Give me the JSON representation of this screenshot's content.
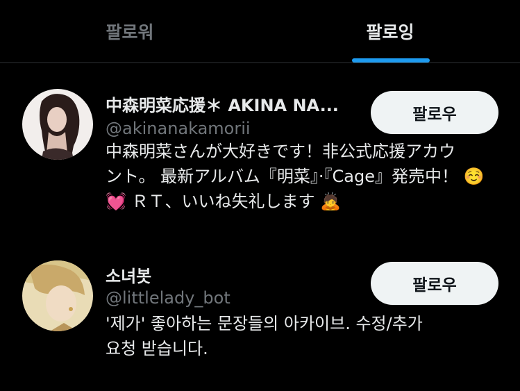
{
  "tabs": {
    "followers_label": "팔로워",
    "following_label": "팔로잉"
  },
  "users": [
    {
      "name": "中森明菜応援＊ AKINA NA...",
      "handle": "@akinanakamorii",
      "bio_line1": "中森明菜さんが大好きです！非公式応援アカウ",
      "bio_line2": "ント。 最新アルバム『明菜』·『Cage』発売中！ ☺️",
      "bio_line3": "💓 ＲＴ、いいね失礼します 🙇",
      "follow_label": "팔로우"
    },
    {
      "name": "소녀봇",
      "handle": "@littlelady_bot",
      "bio_line1": "'제가' 좋아하는 문장들의 아카이브. 수정/추가",
      "bio_line2": "요청 받습니다.",
      "follow_label": "팔로우"
    }
  ],
  "colors": {
    "background": "#000000",
    "primary_text": "#e7e9ea",
    "secondary_text": "#71767b",
    "accent": "#1d9bf0",
    "button_bg": "#eff3f4"
  }
}
